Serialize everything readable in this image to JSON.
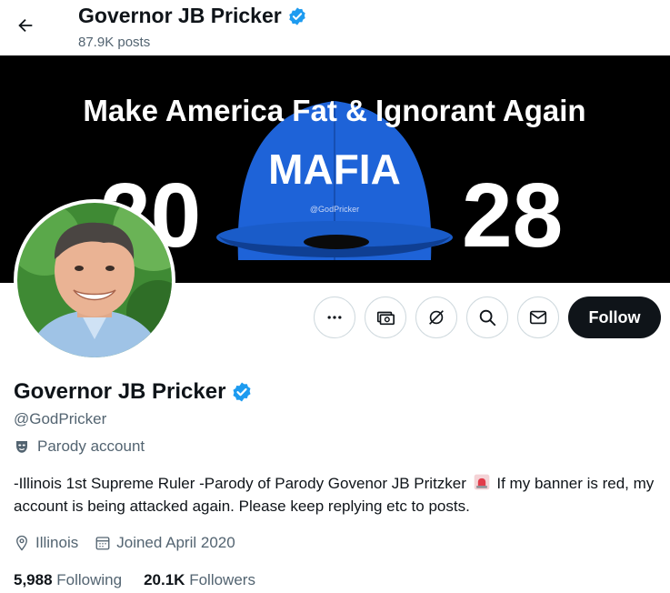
{
  "header": {
    "name": "Governor JB Pricker",
    "posts": "87.9K posts"
  },
  "banner": {
    "headline": "Make America Fat & Ignorant Again",
    "hat_text": "MAFIA",
    "hat_tag": "@GodPricker",
    "year_left": "20",
    "year_right": "28"
  },
  "profile": {
    "name": "Governor JB Pricker",
    "handle": "@GodPricker",
    "label": "Parody account",
    "bio_part1": "-Illinois 1st Supreme Ruler -Parody of Parody Govenor JB Pritzker",
    "bio_part2": "If my banner is red, my account is being attacked again. Please keep replying etc to posts.",
    "location": "Illinois",
    "joined": "Joined April 2020"
  },
  "stats": {
    "following_count": "5,988",
    "following_label": "Following",
    "followers_count": "20.1K",
    "followers_label": "Followers"
  },
  "actions": {
    "follow_label": "Follow"
  },
  "colors": {
    "verified": "#1d9bf0",
    "hat": "#1d5fd6",
    "follow_bg": "#0f1419"
  }
}
